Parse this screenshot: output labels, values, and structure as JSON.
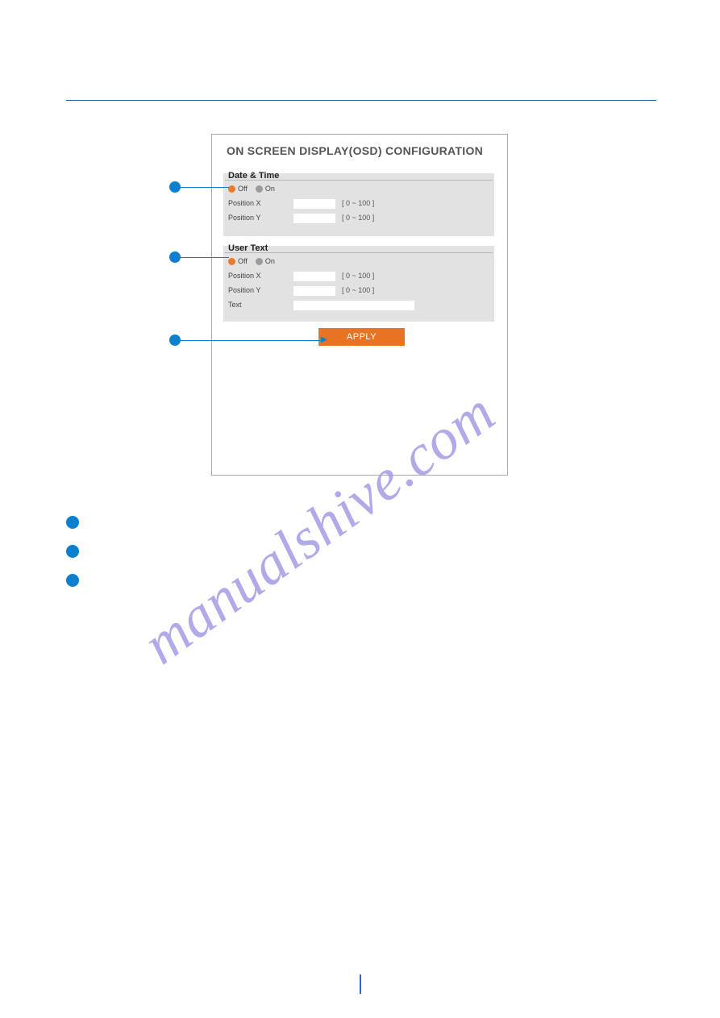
{
  "top_line": "",
  "panel": {
    "title": "ON SCREEN DISPLAY(OSD) CONFIGURATION",
    "date_time": {
      "legend": "Date & Time",
      "off": "Off",
      "on": "On",
      "pos_x_label": "Position X",
      "pos_y_label": "Position Y",
      "range": "[ 0 ~ 100 ]"
    },
    "user_text": {
      "legend": "User Text",
      "off": "Off",
      "on": "On",
      "pos_x_label": "Position X",
      "pos_y_label": "Position Y",
      "text_label": "Text",
      "range": "[ 0 ~ 100 ]"
    },
    "apply": "APPLY"
  },
  "items": {
    "i1": "",
    "i2": "",
    "i3": ""
  },
  "watermark": "manualshive.com"
}
